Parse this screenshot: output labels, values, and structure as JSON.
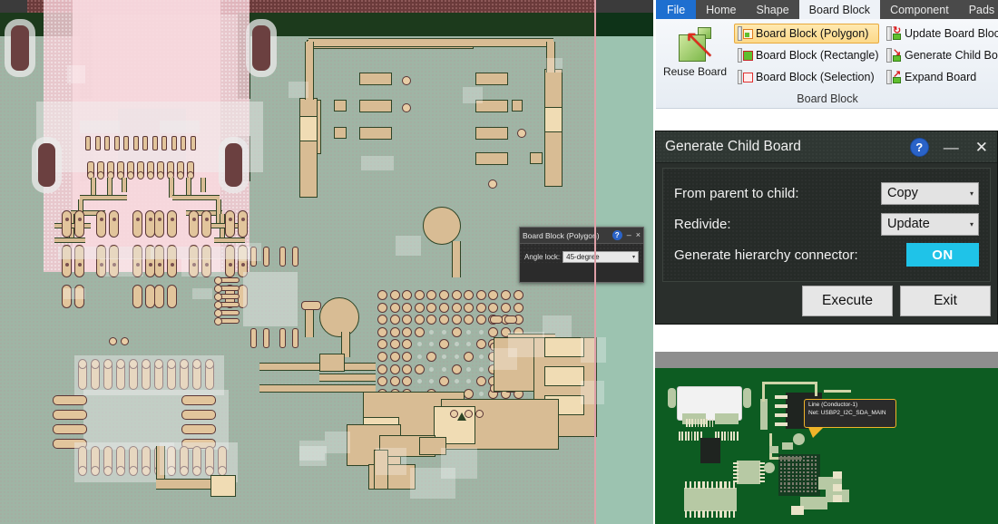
{
  "ribbon": {
    "tabs": [
      {
        "label": "File",
        "state": "file"
      },
      {
        "label": "Home",
        "state": "normal"
      },
      {
        "label": "Shape",
        "state": "normal"
      },
      {
        "label": "Board Block",
        "state": "active"
      },
      {
        "label": "Component",
        "state": "normal"
      },
      {
        "label": "Pads",
        "state": "normal"
      }
    ],
    "reuse_board_label": "Reuse Board",
    "items_left": [
      {
        "label": "Board Block (Polygon)",
        "selected": true,
        "icon": "board-block-polygon-icon"
      },
      {
        "label": "Board Block (Rectangle)",
        "selected": false,
        "icon": "board-block-rectangle-icon"
      },
      {
        "label": "Board Block (Selection)",
        "selected": false,
        "icon": "board-block-selection-icon"
      }
    ],
    "items_right": [
      {
        "label": "Update Board Block",
        "icon": "update-board-block-icon"
      },
      {
        "label": "Generate Child Board",
        "icon": "generate-child-board-icon"
      },
      {
        "label": "Expand Board",
        "icon": "expand-board-icon"
      }
    ],
    "group_label": "Board Block"
  },
  "mini_panel": {
    "title": "Board Block (Polygon)",
    "help": "?",
    "minimize": "–",
    "close": "×",
    "angle_lock_label": "Angle lock:",
    "angle_lock_value": "45-degree",
    "arrow": "▾"
  },
  "dialog": {
    "title": "Generate Child Board",
    "help": "?",
    "minimize": "—",
    "close": "✕",
    "rows": [
      {
        "label": "From parent to child:",
        "value": "Copy",
        "type": "select"
      },
      {
        "label": "Redivide:",
        "value": "Update",
        "type": "select"
      },
      {
        "label": "Generate hierarchy connector:",
        "value": "ON",
        "type": "toggle"
      }
    ],
    "arrow": "▾",
    "execute_label": "Execute",
    "exit_label": "Exit",
    "toggle_color": "#1fc3e8"
  },
  "preview": {
    "tooltip_line1": "Line (Conductor-1)",
    "tooltip_line2": "Net: USBP2_I2C_SDA_MAIN",
    "board_color": "#0d5c22",
    "tooltip_border": "#f0b429"
  },
  "canvas": {
    "plane_color": "#9fb5a5",
    "outside_color": "#9cc3b0",
    "copper_color": "#d8bc94",
    "outline_color": "#2e4426",
    "board_edge_color": "#e0a0a8",
    "connector_highlight_color": "#f3cbd3"
  }
}
